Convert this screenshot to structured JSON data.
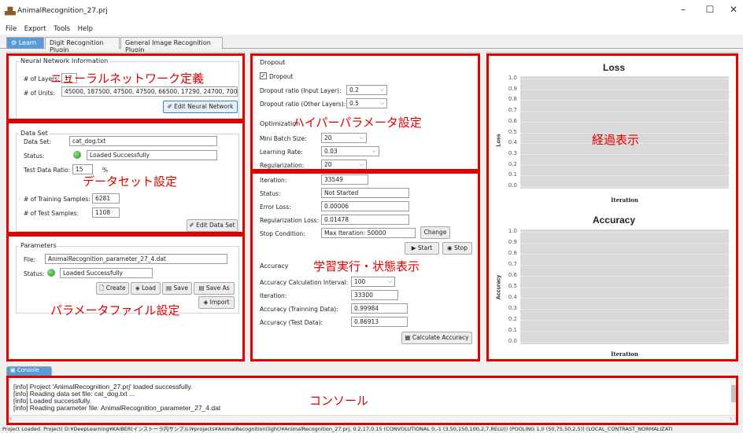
{
  "window": {
    "title": "AnimalRecognition_27.prj",
    "minimize": "–",
    "maximize": "☐",
    "close": "✕"
  },
  "menu": [
    "File",
    "Export",
    "Tools",
    "Help"
  ],
  "tabs": [
    {
      "label": "Learn",
      "active": true
    },
    {
      "label": "Digit Recognition Plugin",
      "active": false
    },
    {
      "label": "General Image Recognition Plugin",
      "active": false
    }
  ],
  "nn_info": {
    "title": "Neural Network Information",
    "layers_label": "# of Layers:",
    "layers_value": "17",
    "units_label": "# of Units:",
    "units_value": "45000, 187500, 47500, 47500, 66500, 17290, 24700, 7000, 8400,",
    "edit_button": "Edit Neural Network"
  },
  "data_set": {
    "title": "Data Set",
    "data_set_label": "Data Set:",
    "data_set_value": "cat_dog.txt",
    "status_label": "Status:",
    "status_value": "Loaded Successfully",
    "test_ratio_label": "Test Data Ratio:",
    "test_ratio_value": "15",
    "test_ratio_unit": "%",
    "training_samples_label": "# of Training Samples:",
    "training_samples_value": "6281",
    "test_samples_label": "# of Test Samples:",
    "test_samples_value": "1108",
    "edit_button": "Edit Data Set"
  },
  "parameters": {
    "title": "Parameters",
    "file_label": "File:",
    "file_value": "AnimalRecognition_parameter_27_4.dat",
    "status_label": "Status:",
    "status_value": "Loaded Successfully",
    "create": "Create",
    "load": "Load",
    "save": "Save",
    "save_as": "Save As",
    "import": "Import"
  },
  "dropout": {
    "title": "Dropout",
    "checkbox_label": "Dropout",
    "checked": true,
    "input_label": "Dropout ratio (Input Layer):",
    "input_value": "0.2",
    "other_label": "Dropout ratio (Other Layers):",
    "other_value": "0.5"
  },
  "optimization": {
    "title": "Optimization",
    "batch_label": "Mini Batch Size:",
    "batch_value": "20",
    "lr_label": "Learning Rate:",
    "lr_value": "0.03",
    "reg_label": "Regularization:",
    "reg_value": "20"
  },
  "learning": {
    "iteration_label": "Iteration:",
    "iteration_value": "33549",
    "status_label": "Status:",
    "status_value": "Not Started",
    "error_loss_label": "Error Loss:",
    "error_loss_value": "0.00006",
    "reg_loss_label": "Regularization Loss:",
    "reg_loss_value": "0.01478",
    "stop_label": "Stop Condition:",
    "stop_value": "Max Iteration: 50000",
    "change": "Change",
    "start": "Start",
    "stop": "Stop"
  },
  "accuracy": {
    "title": "Accuracy",
    "interval_label": "Accuracy Calculation Interval:",
    "interval_value": "100",
    "iteration_label": "Iteration:",
    "iteration_value": "33300",
    "train_label": "Accuracy (Trainning Data):",
    "train_value": "0.99984",
    "test_label": "Accuracy (Test Data):",
    "test_value": "0.86913",
    "calc_button": "Calculate Accuracy"
  },
  "annotations": {
    "nn": "ニューラルネットワーク定義",
    "dataset": "データセット設定",
    "param": "パラメータファイル設定",
    "hyper": "ハイパーパラメータ設定",
    "learn": "学習実行・状態表示",
    "progress": "経過表示",
    "console": "コンソール"
  },
  "chart_data": [
    {
      "type": "line",
      "title": "Loss",
      "xlabel": "Iteration",
      "ylabel": "Loss",
      "ylim": [
        0.0,
        1.0
      ],
      "yticks": [
        "1.0",
        "0.9",
        "0.8",
        "0.7",
        "0.6",
        "0.5",
        "0.4",
        "0.3",
        "0.2",
        "0.1",
        "0.0"
      ],
      "series": []
    },
    {
      "type": "line",
      "title": "Accuracy",
      "xlabel": "Iteration",
      "ylabel": "Accuracy",
      "ylim": [
        0.0,
        1.0
      ],
      "yticks": [
        "1.0",
        "0.9",
        "0.8",
        "0.7",
        "0.6",
        "0.5",
        "0.4",
        "0.3",
        "0.2",
        "0.1",
        "0.0"
      ],
      "series": []
    }
  ],
  "console": {
    "tab_label": "Console",
    "lines": [
      "[info] Project 'AnimalRecognition_27.prj' loaded successfully.",
      "[info] Reading data set file: cat_dog.txt ...",
      "[info] Loaded successfully.",
      "[info] Reading parameter file: AnimalRecognition_parameter_27_4.dat"
    ]
  },
  "statusbar": "Project Loaded. Project( D:¥DeepLearning¥KAIBER(インストーラ内サンプル)¥projects¥AnimalRecognition(light)¥AnimalRecognition_27.prj, 0.2,17,0.15 (CONVOLUTIONAL 0,-1 (3,50,150,100,2,7,RELU)) (POOLING 1,0 (50,75,50,2,5)) (LOCAL_CONTRAST_NORMALIZATI",
  "colors": {
    "accent": "#e00000",
    "tab_active": "#5b9bd5",
    "plot_bg": "#d9d9d9",
    "ok": "#1e8f1e"
  }
}
